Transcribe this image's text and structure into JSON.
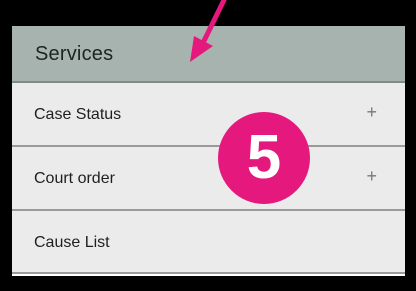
{
  "sidebar": {
    "header": "Services",
    "items": [
      {
        "label": "Case Status",
        "expand_icon": "+"
      },
      {
        "label": "Court order",
        "expand_icon": "+"
      },
      {
        "label": "Cause List"
      }
    ]
  },
  "annotation": {
    "step_number": "5",
    "badge_color": "#e5197d",
    "arrow_color": "#e5197d"
  },
  "colors": {
    "header_bg": "#a7b3ae",
    "item_bg": "#ebebeb",
    "frame_bg": "#000000"
  }
}
